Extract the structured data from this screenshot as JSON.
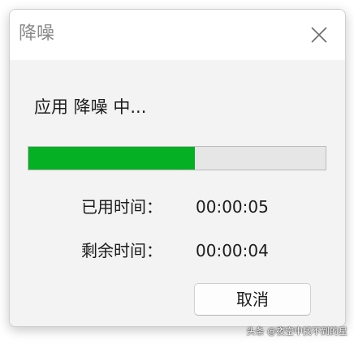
{
  "dialog": {
    "title": "降噪",
    "close_icon": "close-icon",
    "status_text": "应用 降噪 中...",
    "progress": {
      "percent": 56,
      "fill_color": "#06b025",
      "track_color": "#e6e6e6"
    },
    "elapsed": {
      "label": "已用时间：",
      "value": "00:00:05"
    },
    "remaining": {
      "label": "剩余时间：",
      "value": "00:00:04"
    },
    "cancel_label": "取消"
  },
  "watermark": "头条 @夜空中找不到的星"
}
